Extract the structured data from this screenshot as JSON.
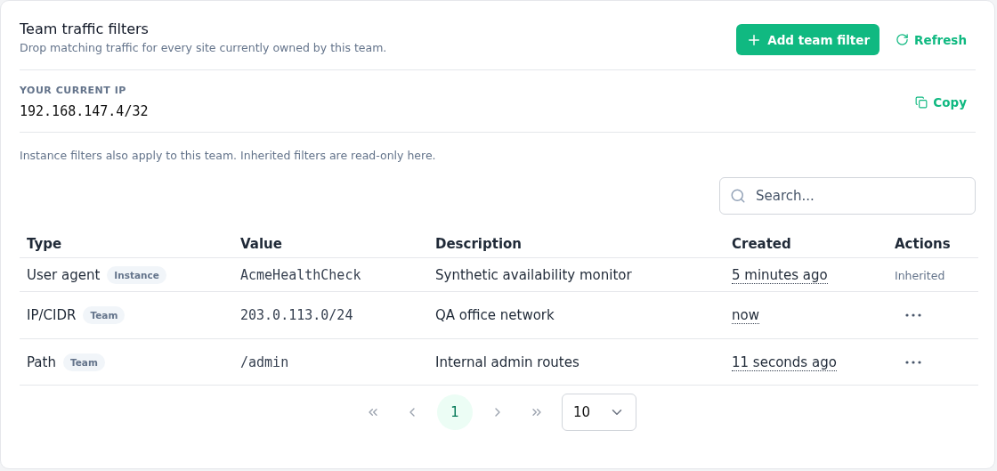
{
  "header": {
    "title": "Team traffic filters",
    "subtitle": "Drop matching traffic for every site currently owned by this team.",
    "buttons": [
      {
        "kind": "primary",
        "label": "Add team filter"
      },
      {
        "kind": "link",
        "label": "Refresh"
      }
    ]
  },
  "current_ip": {
    "label": "YOUR CURRENT IP",
    "value": "192.168.147.4/32",
    "copy_label": "Copy"
  },
  "note": "Instance filters also apply to this team. Inherited filters are read-only here.",
  "search": {
    "placeholder": "Search..."
  },
  "table": {
    "columns": [
      "Type",
      "Value",
      "Description",
      "Created",
      "Actions"
    ],
    "rows": [
      {
        "type": "User agent",
        "scope": "Instance",
        "value": "AcmeHealthCheck",
        "description": "Synthetic availability monitor",
        "created": "5 minutes ago",
        "action": {
          "kind": "text",
          "label": "Inherited"
        }
      },
      {
        "type": "IP/CIDR",
        "scope": "Team",
        "value": "203.0.113.0/24",
        "description": "QA office network",
        "created": "now",
        "action": {
          "kind": "menu"
        }
      },
      {
        "type": "Path",
        "scope": "Team",
        "value": "/admin",
        "description": "Internal admin routes",
        "created": "11 seconds ago",
        "action": {
          "kind": "menu"
        }
      }
    ]
  },
  "pagination": {
    "pages": [
      {
        "label": "1",
        "selected": true
      }
    ],
    "page_size": "10"
  }
}
